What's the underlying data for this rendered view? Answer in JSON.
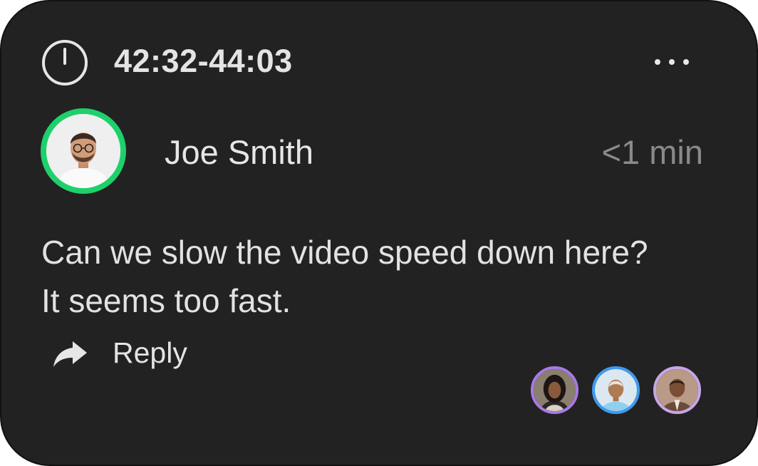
{
  "comment": {
    "time_range": "42:32-44:03",
    "author": "Joe Smith",
    "time_ago": "<1 min",
    "message_lines": [
      "Can we slow the video speed down here?",
      "It seems too fast."
    ],
    "reply_label": "Reply"
  },
  "colors": {
    "card_background": "#222222",
    "author_ring": "#1ed06b",
    "participant_rings": [
      "#a77ae6",
      "#3d9bf0",
      "#c8a6e9"
    ]
  },
  "icons": {
    "timer": "timer-icon",
    "more": "more-options-icon",
    "reply": "reply-arrow-icon"
  },
  "participants_count": 3
}
